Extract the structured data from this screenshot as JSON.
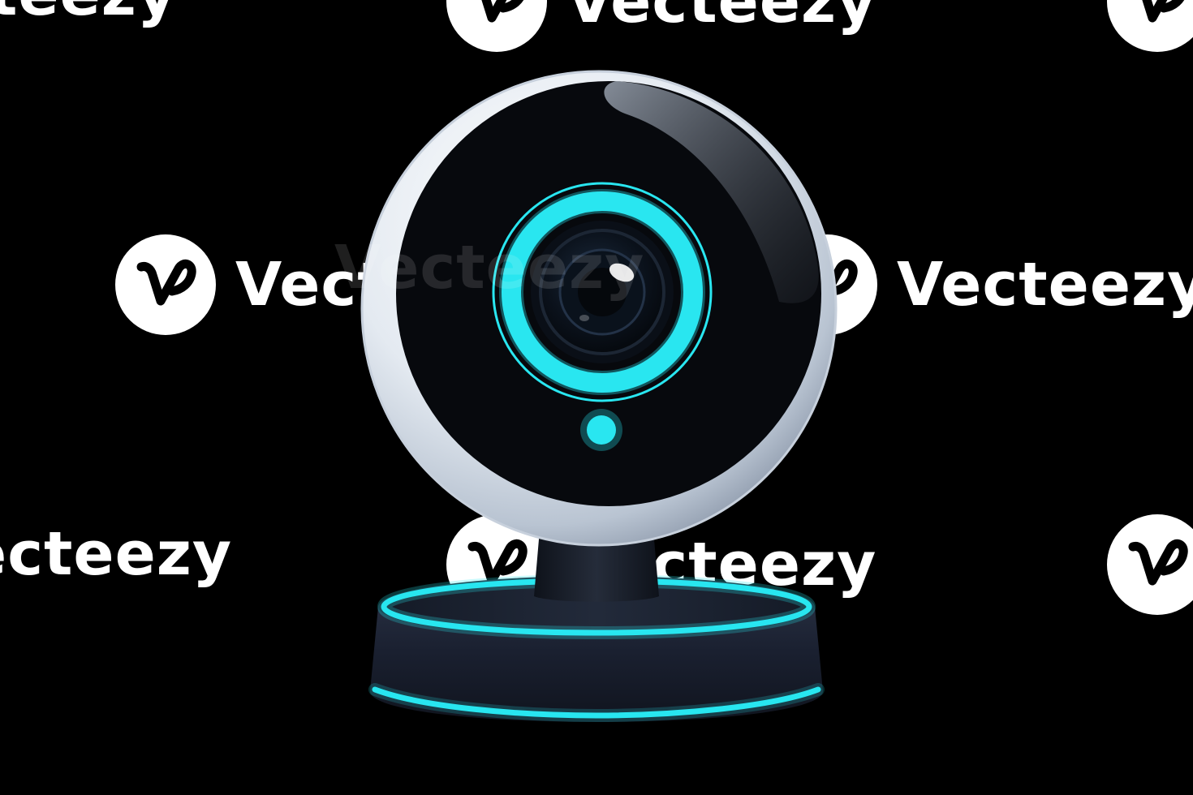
{
  "watermark": {
    "brand_text": "Vecteezy",
    "partial_left": "ecteezy",
    "partial_left_bottom": "ecteezy",
    "logo_icon": "vecteezy-v-logo-icon",
    "text_color": "#ffffff"
  },
  "subject": {
    "name": "webcam",
    "accent_color": "#29e6f0",
    "body_color": "#e6ecf2",
    "face_color": "#07090d",
    "base_color": "#1b2130"
  },
  "background": {
    "color": "#000000"
  }
}
